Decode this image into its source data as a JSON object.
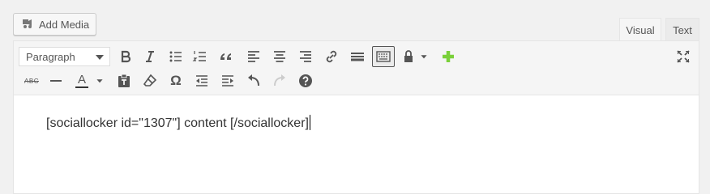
{
  "add_media": {
    "label": "Add Media",
    "icon": "media-icon"
  },
  "tabs": [
    {
      "label": "Visual",
      "active": true
    },
    {
      "label": "Text",
      "active": false
    }
  ],
  "toolbar": {
    "format_select": {
      "value": "Paragraph"
    },
    "row1_icons": [
      "bold-icon",
      "italic-icon",
      "bullet-list-icon",
      "numbered-list-icon",
      "blockquote-icon",
      "align-left-icon",
      "align-center-icon",
      "align-right-icon",
      "link-icon",
      "read-more-icon",
      "toolbar-toggle-icon",
      "lock-icon",
      "caret-icon",
      "plus-icon",
      "fullscreen-icon"
    ],
    "row2_icons": [
      "strikethrough-icon",
      "horizontal-line-icon",
      "text-color-icon",
      "caret-icon",
      "paste-text-icon",
      "clear-formatting-icon",
      "special-character-icon",
      "outdent-icon",
      "indent-icon",
      "undo-icon",
      "redo-icon",
      "help-icon"
    ],
    "strike_label": "ABC",
    "text_color_label": "A",
    "omega": "Ω",
    "accent_plus": "#7ad03a"
  },
  "editor": {
    "content": "[sociallocker id=\"1307\"] content [/sociallocker]"
  }
}
